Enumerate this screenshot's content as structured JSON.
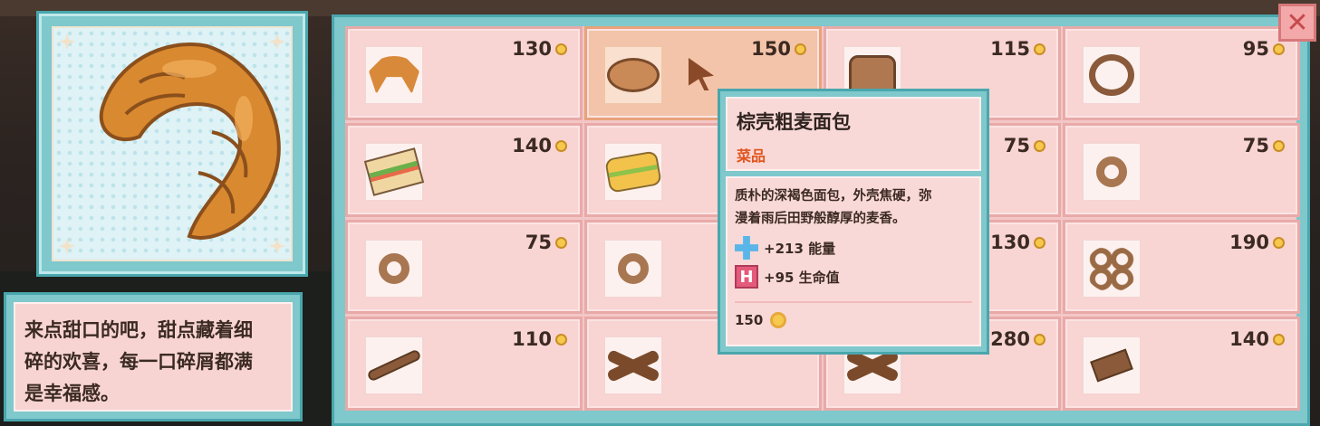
{
  "portrait": {
    "item": "croissant"
  },
  "description": {
    "lines": [
      "来点甜口的吧，甜点藏着细",
      "碎的欢喜，每一口碎屑都满",
      "是幸福感。"
    ]
  },
  "close_label": "✕",
  "slots": [
    {
      "price": "130",
      "food": "croissant",
      "icon": "croissant-icon"
    },
    {
      "price": "150",
      "food": "bread",
      "icon": "bread-icon",
      "selected": true
    },
    {
      "price": "115",
      "food": "toast",
      "icon": "toast-icon"
    },
    {
      "price": "95",
      "food": "pretzel",
      "icon": "pretzel-icon"
    },
    {
      "price": "140",
      "food": "sandwich",
      "icon": "sandwich-icon"
    },
    {
      "price": "",
      "food": "sandwich2",
      "icon": "sandwich-icon"
    },
    {
      "price": "75",
      "food": "",
      "icon": ""
    },
    {
      "price": "75",
      "food": "donut",
      "icon": "donut-icon"
    },
    {
      "price": "75",
      "food": "donut",
      "icon": "donut-icon"
    },
    {
      "price": "",
      "food": "donut",
      "icon": "donut-icon"
    },
    {
      "price": "130",
      "food": "",
      "icon": ""
    },
    {
      "price": "190",
      "food": "donuts",
      "icon": "donuts-icon"
    },
    {
      "price": "110",
      "food": "stick",
      "icon": "breadstick-icon"
    },
    {
      "price": "",
      "food": "cross",
      "icon": "breadsticks-icon"
    },
    {
      "price": "280",
      "food": "cross",
      "icon": "breadsticks-icon"
    },
    {
      "price": "140",
      "food": "bar",
      "icon": "bar-icon"
    }
  ],
  "tooltip": {
    "title": "棕壳粗麦面包",
    "category": "菜品",
    "desc_lines": [
      "质朴的深褐色面包，外壳焦硬，弥",
      "漫着雨后田野般醇厚的麦香。"
    ],
    "stats": [
      {
        "icon": "plus-icon",
        "text": "+213 能量"
      },
      {
        "icon": "heart-h-icon",
        "text": "+95 生命值"
      }
    ],
    "price": "150"
  },
  "colors": {
    "frame": "#7fc8cc",
    "slot_bg": "#f8d4d3",
    "selected_bg": "#f3c4a9",
    "category": "#e0561f"
  }
}
